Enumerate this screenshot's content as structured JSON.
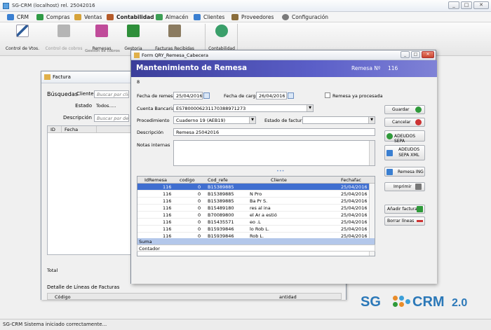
{
  "window": {
    "title": "SG-CRM (localhost) rel. 25042016",
    "min": "_",
    "max": "□",
    "close": "✕"
  },
  "menu": [
    {
      "label": "CRM",
      "color": "#3a7fd1"
    },
    {
      "label": "Compras",
      "color": "#2f9a45"
    },
    {
      "label": "Ventas",
      "color": "#d6a33a"
    },
    {
      "label": "Contabilidad",
      "color": "#b55b2a"
    },
    {
      "label": "Almacén",
      "color": "#3c9f55"
    },
    {
      "label": "Clientes",
      "color": "#3a7fd1"
    },
    {
      "label": "Proveedores",
      "color": "#8a6d3b"
    },
    {
      "label": "Configuración",
      "color": "#7a7a7a"
    }
  ],
  "ribbon": {
    "buttons": [
      {
        "label": "Control de Vtos.",
        "color": "#2e5c99"
      },
      {
        "label": "Control de cobros",
        "color": "#9a9a9a"
      },
      {
        "label": "Remesas",
        "color": "#c04c9a"
      },
      {
        "label": "Gestoria",
        "color": "#2e8f3a"
      },
      {
        "label": "Facturas Recibidas",
        "color": "#8b7b60"
      },
      {
        "label": "Contabilidad",
        "color": "#3a9f6a"
      }
    ],
    "group_label": "Gestión de cobros"
  },
  "factura": {
    "title": "Factura",
    "busquedas": "Búsquedas",
    "cliente_label": "Cliente",
    "cliente_placeholder": "Buscar por cliente",
    "estado_label": "Estado",
    "estado_value": "Todos.....",
    "descripcion_label": "Descripción",
    "descripcion_placeholder": "Buscar por descr",
    "col_id": "ID",
    "col_fecha": "Fecha",
    "total": "Total",
    "detalle": "Detalle de Líneas de Facturas",
    "col_codigo": "Código",
    "col_cantidad": "antidad"
  },
  "remesa": {
    "title": "Form QRY_Remesa_Cabecera",
    "heading": "Mantenimiento de Remesa",
    "remesa_label": "Remesa Nº",
    "remesa_num": "116",
    "row_count": "8",
    "fecha_remesa_label": "Fecha de remesa",
    "fecha_remesa": "25/04/2016",
    "fecha_cargo_label": "Fecha de cargo",
    "fecha_cargo": "26/04/2016",
    "procesada_label": "Remesa ya procesada",
    "cuenta_label": "Cuenta Bancaria",
    "cuenta_value": "ES7800006231170388971273",
    "proc_label": "Procedimiento",
    "proc_value": "Cuaderno 19 (AEB19)",
    "estado_fact_label": "Estado de facturas",
    "desc_label": "Descripción",
    "desc_value": "Remesa 25042016",
    "notas_label": "Notas internas",
    "grid": {
      "cols": [
        "IdRemesa",
        "codigo",
        "Cod_refe",
        "Cliente",
        "Fechafac"
      ],
      "rows": [
        [
          "116",
          "0",
          "B15389885",
          "",
          "25/04/2016"
        ],
        [
          "116",
          "0",
          "B15389885",
          "N Pro",
          "25/04/2016"
        ],
        [
          "116",
          "0",
          "B15389885",
          "Ba Pr         S.",
          "25/04/2016"
        ],
        [
          "116",
          "0",
          "B15489180",
          "       res al   ina",
          "25/04/2016"
        ],
        [
          "116",
          "0",
          "B70089800",
          "        el  Ar    a  estió",
          "25/04/2016"
        ],
        [
          "116",
          "0",
          "B15435571",
          "          eo    .L",
          "25/04/2016"
        ],
        [
          "116",
          "0",
          "B15939846",
          "      lo  Rob    L.",
          "25/04/2016"
        ],
        [
          "116",
          "0",
          "B15939846",
          "         Rob    L.",
          "25/04/2016"
        ],
        [
          "116",
          "0",
          "B15251432",
          "A             .L.",
          "25/04/2016"
        ]
      ],
      "suma": "Suma",
      "contador": "Contador"
    },
    "buttons": [
      {
        "label": "Guardar",
        "color": "#2f9a3a"
      },
      {
        "label": "Cancelar",
        "color": "#cc3333"
      },
      {
        "label": "ADEUDOS SEPA",
        "color": "#2f9a3a"
      },
      {
        "label": "ADEUDOS SEPA XML",
        "color": "#3a7fd1"
      },
      {
        "label": "Remesa ING",
        "color": "#3a7fd1"
      },
      {
        "label": "Imprimir",
        "color": "#555555"
      },
      {
        "label": "Añadir facturas",
        "color": "#2f9a3a"
      },
      {
        "label": "Borrar líneas",
        "color": "#cc3333"
      }
    ]
  },
  "status": "SG-CRM Sistema iniciado correctamente...",
  "logo": {
    "sg": "SG",
    "crm": "CRM",
    "ver": "2.0"
  }
}
